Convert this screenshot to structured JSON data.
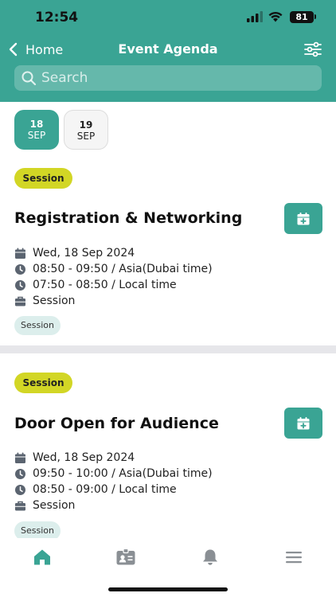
{
  "status_bar": {
    "time": "12:54",
    "battery": "81"
  },
  "nav": {
    "back_label": "Home",
    "title": "Event Agenda"
  },
  "search": {
    "placeholder": "Search"
  },
  "dates": [
    {
      "day": "18",
      "month": "SEP",
      "selected": true
    },
    {
      "day": "19",
      "month": "SEP",
      "selected": false
    }
  ],
  "sessions": [
    {
      "badge": "Session",
      "title": "Registration & Networking",
      "date": "Wed, 18 Sep 2024",
      "time_event": "08:50 - 09:50 / Asia(Dubai time)",
      "time_local": "07:50 - 08:50 / Local time",
      "type": "Session",
      "tag": "Session"
    },
    {
      "badge": "Session",
      "title": "Door Open for Audience",
      "date": "Wed, 18 Sep 2024",
      "time_event": "09:50 - 10:00 / Asia(Dubai time)",
      "time_local": "08:50 - 09:00 / Local time",
      "type": "Session",
      "tag": "Session"
    }
  ],
  "tab_bar": {
    "items": [
      "home-icon",
      "badge-icon",
      "bell-icon",
      "menu-icon"
    ],
    "active": "home-icon"
  },
  "colors": {
    "primary": "#3aa494",
    "badge": "#d2d625",
    "tag_bg": "#dceeec",
    "divider": "#e6e6ea",
    "tab_inactive": "#8a8f94"
  }
}
